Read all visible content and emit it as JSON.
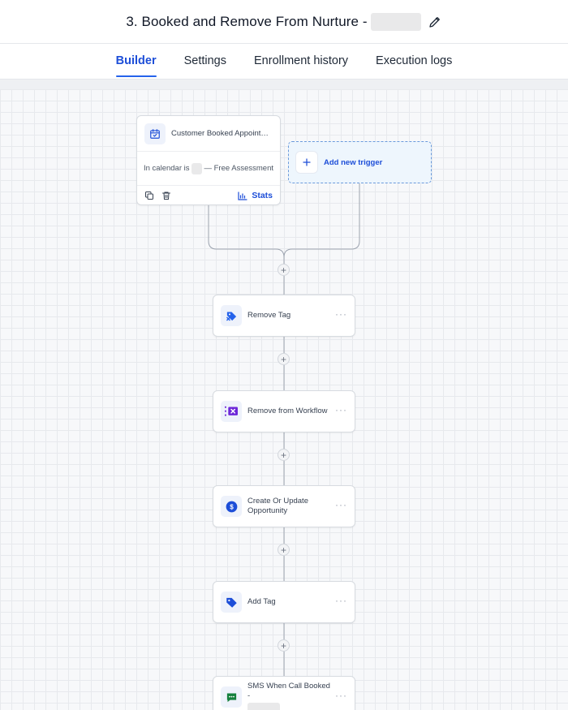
{
  "header": {
    "title": "3. Booked and Remove From Nurture -",
    "edit_icon": "pencil-icon"
  },
  "tabs": [
    {
      "label": "Builder",
      "active": true
    },
    {
      "label": "Settings",
      "active": false
    },
    {
      "label": "Enrollment history",
      "active": false
    },
    {
      "label": "Execution logs",
      "active": false
    }
  ],
  "trigger": {
    "title": "Customer Booked Appointment",
    "condition_prefix": "In calendar is",
    "condition_suffix": "— Free Assessment",
    "stats_label": "Stats",
    "icon": "calendar-check-icon"
  },
  "add_trigger": {
    "label": "Add new trigger"
  },
  "actions": [
    {
      "label": "Remove Tag",
      "icon": "tag-remove-icon"
    },
    {
      "label": "Remove from Workflow",
      "icon": "list-remove-icon"
    },
    {
      "label": "Create Or Update Opportunity",
      "icon": "dollar-icon"
    },
    {
      "label": "Add Tag",
      "icon": "tag-icon"
    },
    {
      "label": "SMS When Call Booked -",
      "icon": "sms-icon"
    }
  ],
  "colors": {
    "accent": "#2563eb",
    "remove_tag_icon": "#2563eb",
    "remove_workflow_icon": "#6d28d9",
    "opportunity_icon": "#1d4ed8",
    "add_tag_icon": "#1d4ed8",
    "sms_icon": "#15803d"
  }
}
